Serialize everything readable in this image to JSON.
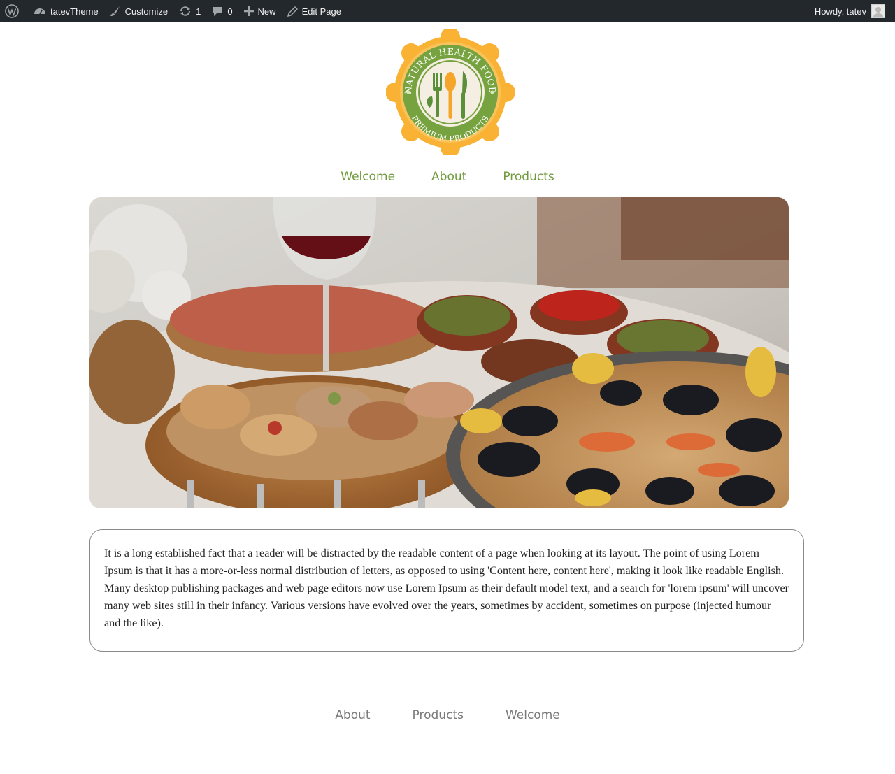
{
  "admin_bar": {
    "site_name": "tatevTheme",
    "customize": "Customize",
    "updates_count": "1",
    "comments_count": "0",
    "new": "New",
    "edit_page": "Edit Page",
    "howdy": "Howdy, tatev"
  },
  "logo": {
    "top_text": "NATURAL HEALTH FOOD",
    "bottom_text": "PREMIUM PRODUCTS",
    "colors": {
      "badge": "#f9b233",
      "ring": "#76a33f",
      "inner": "#f5efe3",
      "knife": "#5b8f3a",
      "spoon": "#f4a52a"
    }
  },
  "nav_top": [
    "Welcome",
    "About",
    "Products"
  ],
  "hero": {
    "description": "food table photo"
  },
  "content": {
    "text": "It is a long established fact that a reader will be distracted by the readable content of a page when looking at its layout. The point of using Lorem Ipsum is that it has a more-or-less normal distribution of letters, as opposed to using 'Content here, content here', making it look like readable English. Many desktop publishing packages and web page editors now use Lorem Ipsum as their default model text, and a search for 'lorem ipsum' will uncover many web sites still in their infancy. Various versions have evolved over the years, sometimes by accident, sometimes on purpose (injected humour and the like)."
  },
  "nav_bottom": [
    "About",
    "Products",
    "Welcome"
  ],
  "colors": {
    "admin_bar_bg": "#23282d",
    "nav_top": "#6f9a3a",
    "nav_bottom": "#7a7a7a"
  }
}
